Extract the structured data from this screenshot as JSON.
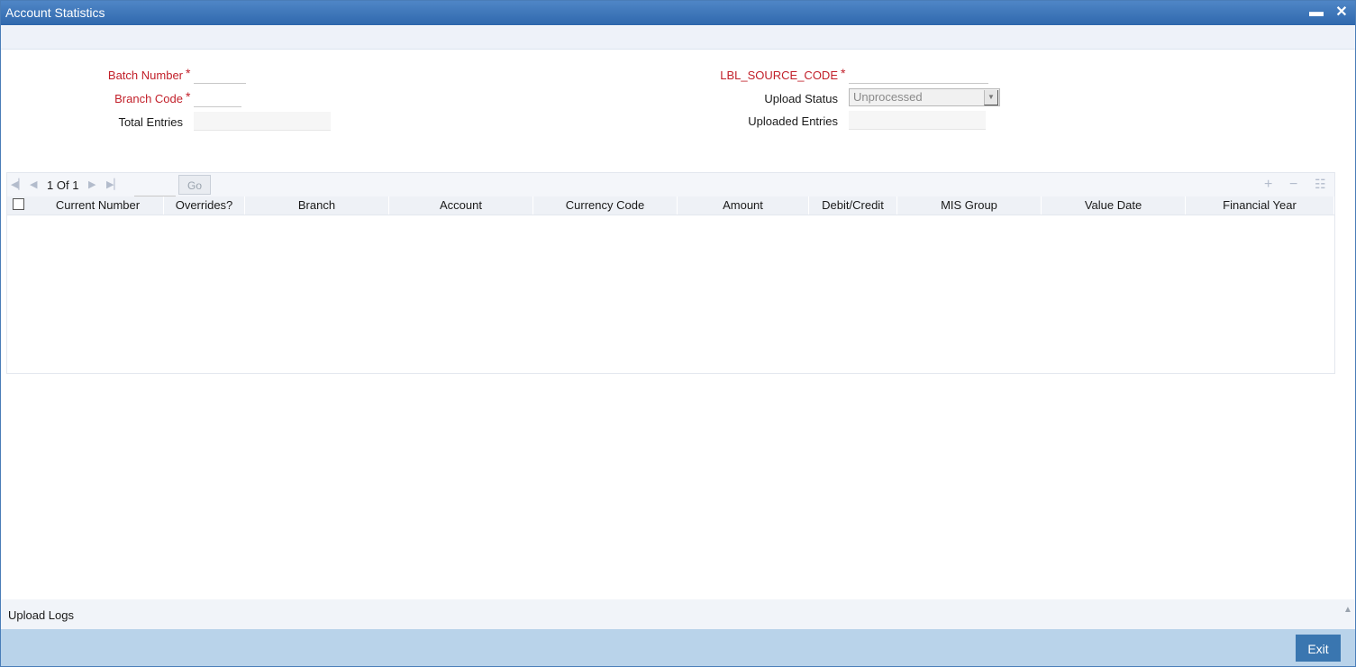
{
  "window": {
    "title": "Account Statistics",
    "minimize_glyph": "▬",
    "close_glyph": "✕"
  },
  "form": {
    "batch_number_label": "Batch Number",
    "branch_code_label": "Branch Code",
    "total_entries_label": "Total Entries",
    "source_code_label": "LBL_SOURCE_CODE",
    "upload_status_label": "Upload Status",
    "upload_status_value": "Unprocessed",
    "uploaded_entries_label": "Uploaded Entries",
    "required_mark": "*"
  },
  "grid": {
    "page_current": "1",
    "page_of": "Of",
    "page_total": "1",
    "go_label": "Go",
    "columns": [
      "Current Number",
      "Overrides?",
      "Branch",
      "Account",
      "Currency Code",
      "Amount",
      "Debit/Credit",
      "MIS Group",
      "Value Date",
      "Financial Year"
    ],
    "rows": []
  },
  "footer": {
    "upload_logs_label": "Upload Logs",
    "exit_label": "Exit"
  },
  "icons": {
    "first": "first-page-icon",
    "prev": "prev-page-icon",
    "next": "next-page-icon",
    "last": "last-page-icon",
    "add": "add-row-icon",
    "delete": "delete-row-icon",
    "view": "single-view-icon"
  }
}
